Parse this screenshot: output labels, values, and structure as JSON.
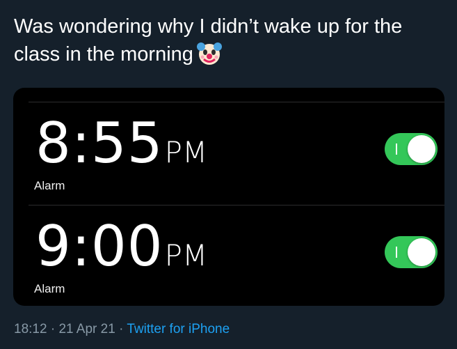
{
  "tweet": {
    "text": "Was wondering why I didn’t wake up for the class in the morning",
    "emoji_icon": "clown-face-icon"
  },
  "alarms": [
    {
      "time": "8:55",
      "ampm": "PM",
      "label": "Alarm",
      "enabled": true
    },
    {
      "time": "9:00",
      "ampm": "PM",
      "label": "Alarm",
      "enabled": true
    }
  ],
  "meta": {
    "time": "18:12",
    "separator": "·",
    "date": "21 Apr 21",
    "source": "Twitter for iPhone"
  },
  "colors": {
    "background": "#15202b",
    "toggle_on": "#34c759",
    "link": "#1da1f2",
    "meta_text": "#8899a6"
  }
}
